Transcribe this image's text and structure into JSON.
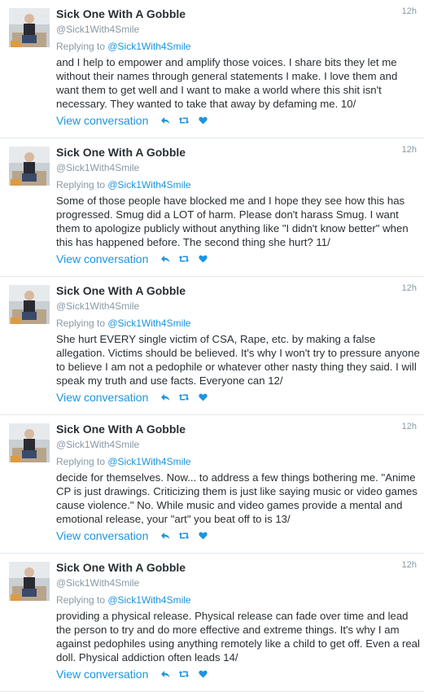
{
  "tweets": [
    {
      "name": "Sick One With A Gobble",
      "handle": "@Sick1With4Smile",
      "time": "12h",
      "replying_prefix": "Replying to ",
      "replying_to": "@Sick1With4Smile",
      "text": "and I help to empower and amplify those voices. I share bits they let me without their names through general statements I make. I love them and want them to get well and I want to make a world where this shit isn't necessary. They wanted to take that away by defaming me. 10/",
      "view_label": "View conversation"
    },
    {
      "name": "Sick One With A Gobble",
      "handle": "@Sick1With4Smile",
      "time": "12h",
      "replying_prefix": "Replying to ",
      "replying_to": "@Sick1With4Smile",
      "text": "Some of those people have blocked me and I hope they see how this has progressed. Smug did a LOT of harm. Please don't harass Smug. I want them to apologize publicly without anything like \"I didn't know better\" when this has happened before. The second thing she hurt? 11/",
      "view_label": "View conversation"
    },
    {
      "name": "Sick One With A Gobble",
      "handle": "@Sick1With4Smile",
      "time": "12h",
      "replying_prefix": "Replying to ",
      "replying_to": "@Sick1With4Smile",
      "text": "She hurt EVERY single victim of CSA, Rape, etc. by making a false allegation. Victims should be believed. It's why I won't try to pressure anyone to believe I am not a pedophile or whatever other nasty thing they said. I will speak my truth and use facts. Everyone can 12/",
      "view_label": "View conversation"
    },
    {
      "name": "Sick One With A Gobble",
      "handle": "@Sick1With4Smile",
      "time": "12h",
      "replying_prefix": "Replying to ",
      "replying_to": "@Sick1With4Smile",
      "text": "decide for themselves. Now... to address a few things bothering me. \"Anime CP is just drawings. Criticizing them is just like saying music or video games cause violence.\" No. While music and video games provide a mental and emotional release, your \"art\" you beat off to is 13/",
      "view_label": "View conversation"
    },
    {
      "name": "Sick One With A Gobble",
      "handle": "@Sick1With4Smile",
      "time": "12h",
      "replying_prefix": "Replying to ",
      "replying_to": "@Sick1With4Smile",
      "text": "providing a physical release. Physical release can fade over time and lead the person to try and do more effective and extreme things. It's why I am against pedophiles using anything remotely like a child to get off. Even a real doll. Physical addiction often leads 14/",
      "view_label": "View conversation"
    }
  ],
  "icons": {
    "reply": "reply-icon",
    "retweet": "retweet-icon",
    "like": "heart-icon"
  },
  "colors": {
    "link": "#1b95e0",
    "muted": "#8899a6",
    "text": "#292f33",
    "divider": "#e1e8ed"
  }
}
